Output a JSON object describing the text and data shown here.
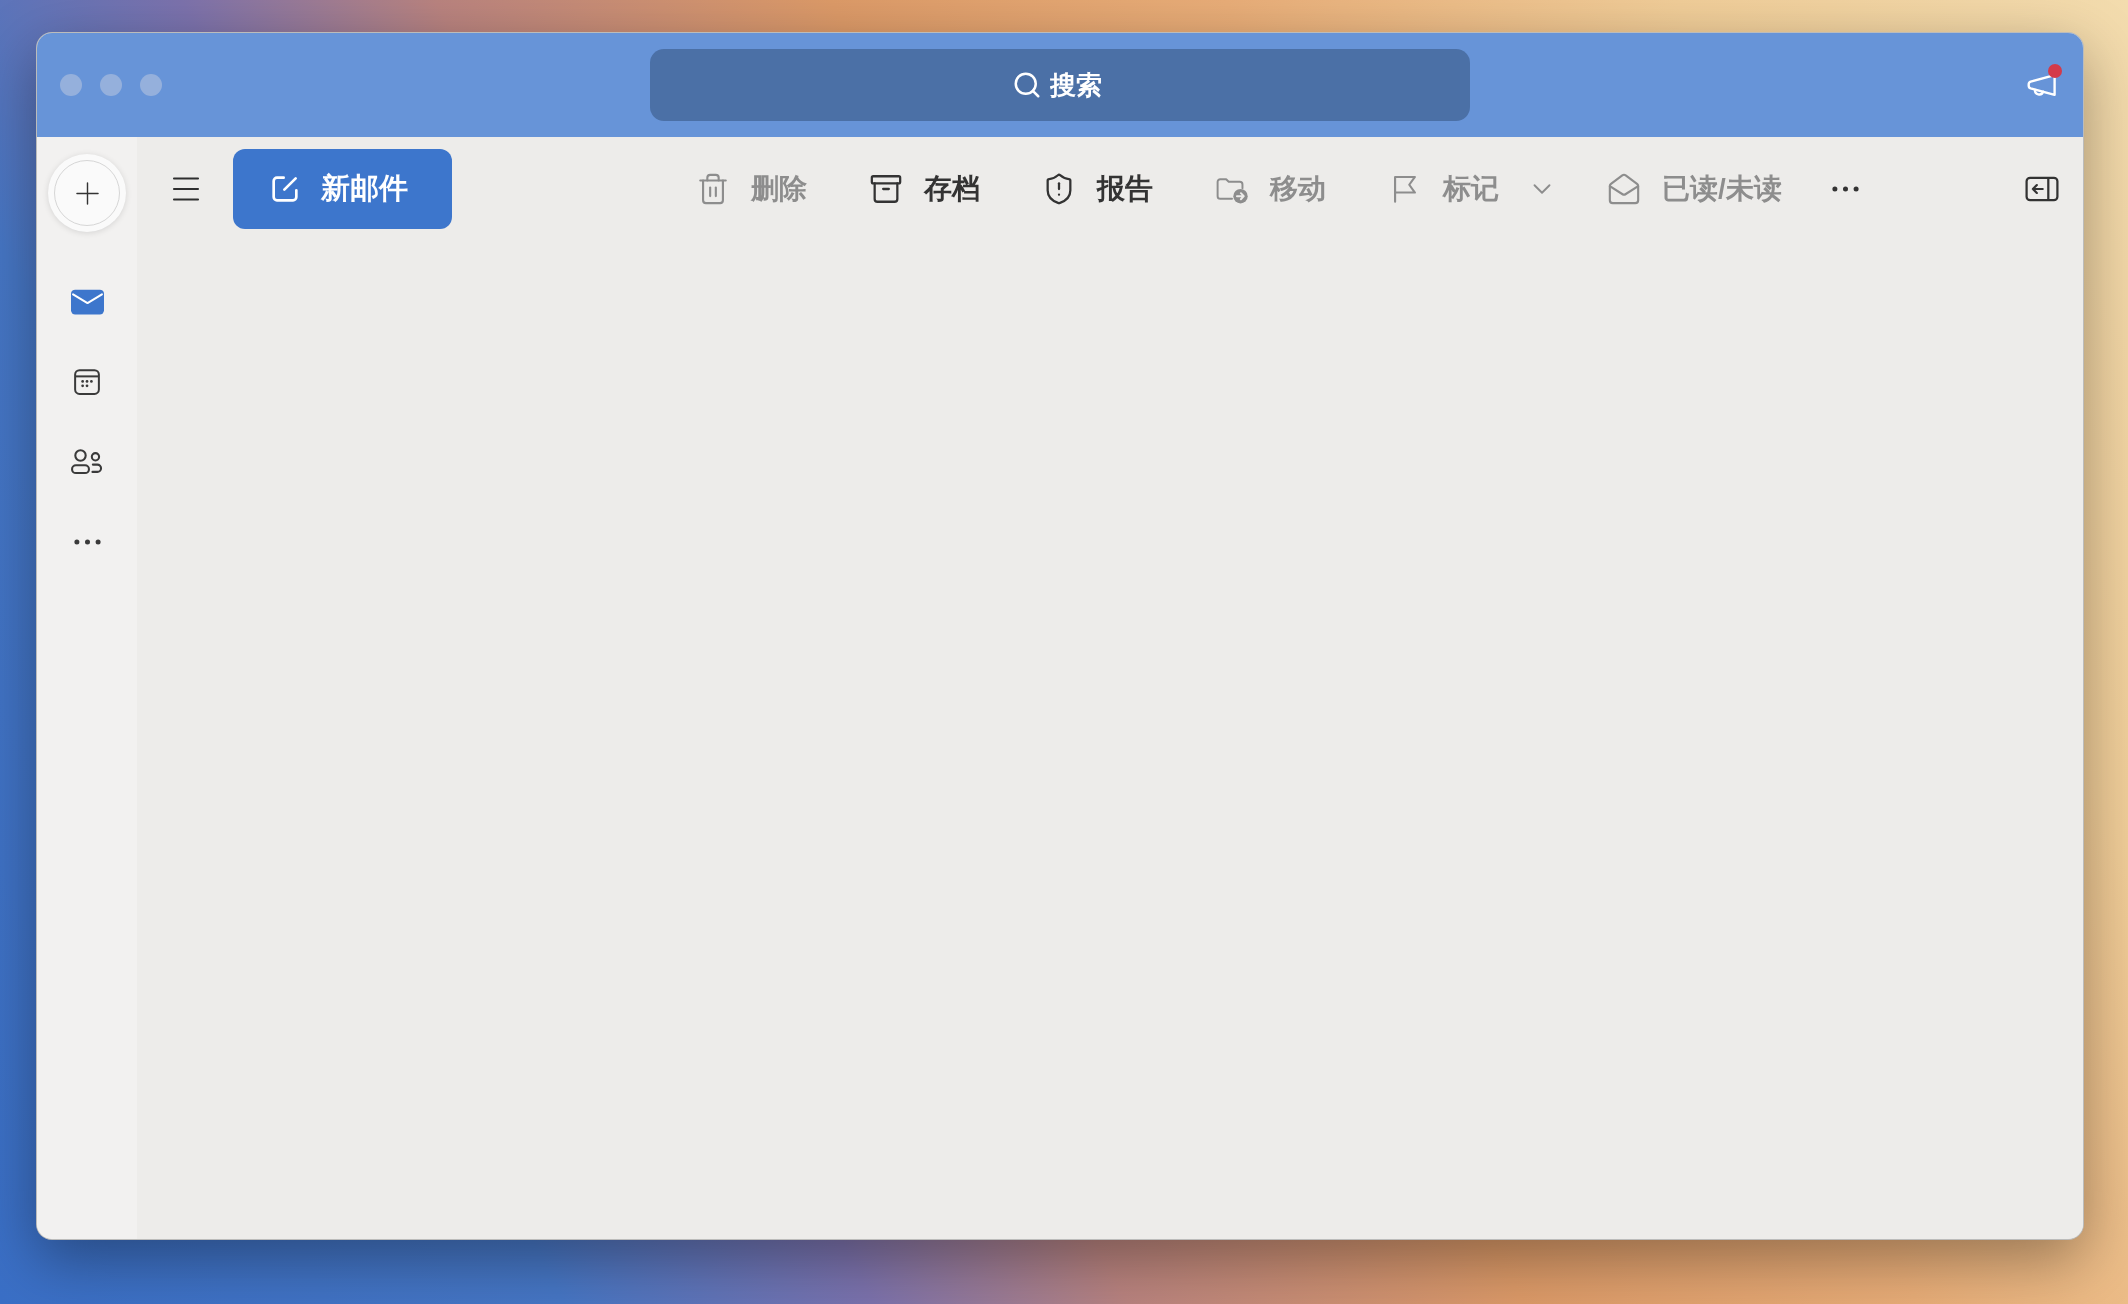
{
  "title_bar": {
    "search": {
      "placeholder": "搜索"
    },
    "announcements": {
      "unread": true
    }
  },
  "sidebar": {
    "items": [
      {
        "selected": true
      },
      {
        "selected": false
      },
      {
        "selected": false
      },
      {
        "selected": false
      }
    ]
  },
  "toolbar": {
    "new_mail": {
      "label": "新邮件"
    },
    "actions": [
      {
        "label": "删除",
        "disabled": true,
        "dropdown": false
      },
      {
        "label": "存档",
        "disabled": false,
        "dropdown": false
      },
      {
        "label": "报告",
        "disabled": false,
        "dropdown": false
      },
      {
        "label": "移动",
        "disabled": true,
        "dropdown": false
      },
      {
        "label": "标记",
        "disabled": true,
        "dropdown": true
      },
      {
        "label": "已读/未读",
        "disabled": true,
        "dropdown": false
      }
    ]
  }
}
